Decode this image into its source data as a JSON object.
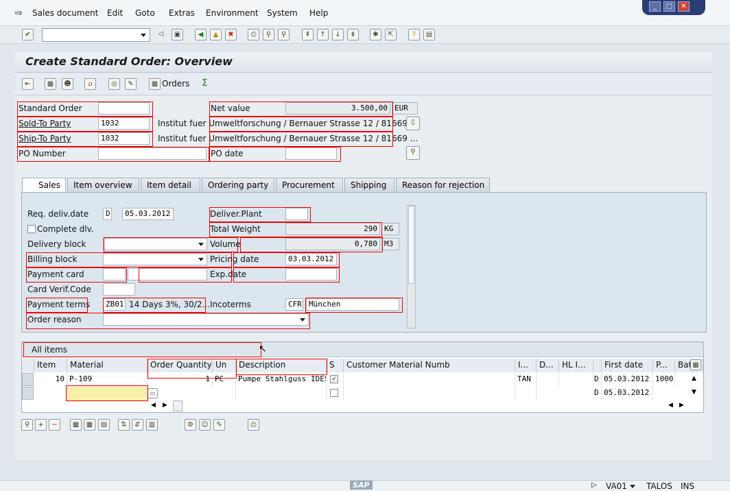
{
  "menu": [
    "Sales document",
    "Edit",
    "Goto",
    "Extras",
    "Environment",
    "System",
    "Help"
  ],
  "title": "Create Standard Order: Overview",
  "app_toolbar": {
    "orders_label": "Orders"
  },
  "header": {
    "order_type_label": "Standard Order",
    "order_type_value": "",
    "net_value_label": "Net value",
    "net_value": "3.500,00",
    "currency": "EUR",
    "sold_to_label": "Sold-To Party",
    "sold_to_value": "1032",
    "sold_to_desc": "Institut fuer Umweltforschung / Bernauer Strasse 12 / 81669 ...",
    "ship_to_label": "Ship-To Party",
    "ship_to_value": "1032",
    "ship_to_desc": "Institut fuer Umweltforschung / Bernauer Strasse 12 / 81669 ...",
    "po_number_label": "PO Number",
    "po_number_value": "",
    "po_date_label": "PO date",
    "po_date_value": ""
  },
  "tabs": [
    "Sales",
    "Item overview",
    "Item detail",
    "Ordering party",
    "Procurement",
    "Shipping",
    "Reason for rejection"
  ],
  "sales": {
    "req_deliv_label": "Req. deliv.date",
    "req_deliv_type": "D",
    "req_deliv_value": "05.03.2012",
    "deliver_plant_label": "Deliver.Plant",
    "complete_dlv_label": "Complete dlv.",
    "total_weight_label": "Total Weight",
    "total_weight_value": "290",
    "total_weight_unit": "KG",
    "delivery_block_label": "Delivery block",
    "volume_label": "Volume",
    "volume_value": "0,780",
    "volume_unit": "M3",
    "billing_block_label": "Billing block",
    "pricing_date_label": "Pricing date",
    "pricing_date_value": "03.03.2012",
    "payment_card_label": "Payment card",
    "exp_date_label": "Exp.date",
    "card_verif_label": "Card Verif.Code",
    "payment_terms_label": "Payment terms",
    "payment_terms_value": "ZB01",
    "payment_terms_desc": "14 Days 3%, 30/2...",
    "incoterms_label": "Incoterms",
    "incoterms_value": "CFR",
    "incoterms_place": "München",
    "order_reason_label": "Order reason"
  },
  "items": {
    "header_label": "All items",
    "columns": [
      "Item",
      "Material",
      "Order Quantity",
      "Un",
      "Description",
      "S",
      "Customer Material Numb",
      "I...",
      "D...",
      "HL I...",
      "First date",
      "P...",
      "Bat"
    ],
    "rows": [
      {
        "item": "10",
        "material": "P-109",
        "qty": "1",
        "un": "PC",
        "desc": "Pumpe Stahlguss IDES...",
        "cat": "TAN",
        "d": "D",
        "date": "05.03.2012",
        "plant": "1000"
      },
      {
        "item": "",
        "material": "",
        "qty": "",
        "un": "",
        "desc": "",
        "cat": "",
        "d": "D",
        "date": "05.03.2012",
        "plant": ""
      }
    ]
  },
  "status": {
    "transaction": "VA01",
    "server": "TALOS",
    "mode": "INS",
    "logo": "SAP"
  }
}
